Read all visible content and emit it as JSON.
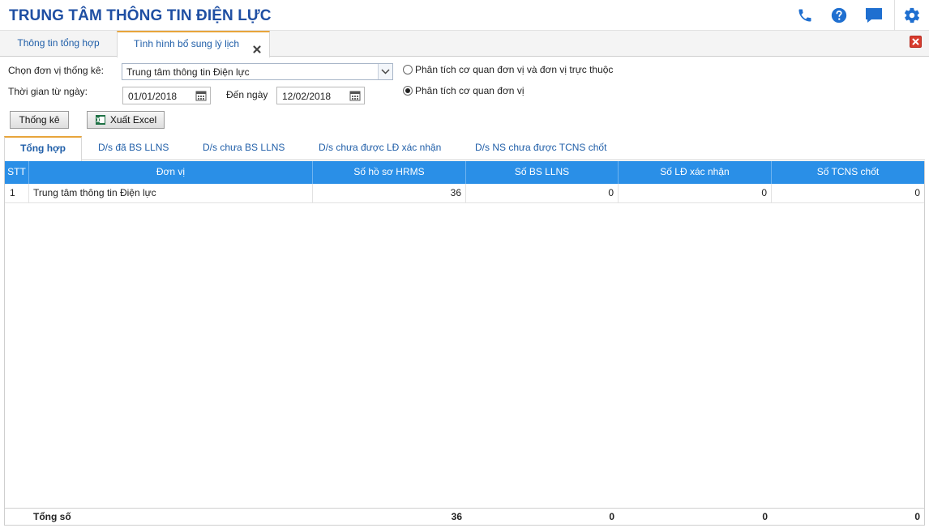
{
  "app": {
    "title": "TRUNG TÂM THÔNG TIN ĐIỆN LỰC"
  },
  "header_icons": [
    "phone-icon",
    "help-icon",
    "chat-icon",
    "gear-icon"
  ],
  "tabs": [
    {
      "label": "Thông tin tổng hợp",
      "active": false
    },
    {
      "label": "Tình hình bổ sung lý lịch",
      "active": true
    }
  ],
  "filters": {
    "unit_label": "Chọn đơn vị thống kê:",
    "unit_value": "Trung tâm thông tin Điện lực",
    "from_label": "Thời gian từ ngày:",
    "from_value": "01/01/2018",
    "to_label": "Đến ngày",
    "to_value": "12/02/2018",
    "radio_1": "Phân tích cơ quan đơn vị và đơn vị trực thuộc",
    "radio_2": "Phân tích cơ quan đơn vị",
    "radio_selected": 2
  },
  "buttons": {
    "stats": "Thống kê",
    "export": "Xuất Excel"
  },
  "sub_tabs": [
    {
      "label": "Tổng hợp",
      "active": true
    },
    {
      "label": "D/s đã BS LLNS",
      "active": false
    },
    {
      "label": "D/s chưa BS LLNS",
      "active": false
    },
    {
      "label": "D/s chưa được LĐ xác nhận",
      "active": false
    },
    {
      "label": "D/s NS chưa được TCNS chốt",
      "active": false
    }
  ],
  "table": {
    "columns": [
      "STT",
      "Đơn vị",
      "Số hồ sơ HRMS",
      "Số BS LLNS",
      "Số LĐ xác nhận",
      "Số TCNS chốt"
    ],
    "rows": [
      [
        "1",
        "Trung tâm thông tin Điện lực",
        "36",
        "0",
        "0",
        "0"
      ]
    ],
    "footer": {
      "label": "Tổng số",
      "hrms": "36",
      "bs_llns": "0",
      "ld_xac_nhan": "0",
      "tcns_chot": "0"
    }
  },
  "colors": {
    "title": "#1f4fa3",
    "accent": "#2a8fe7",
    "tab_active": "#e8a53b",
    "close": "#d83b2d"
  }
}
